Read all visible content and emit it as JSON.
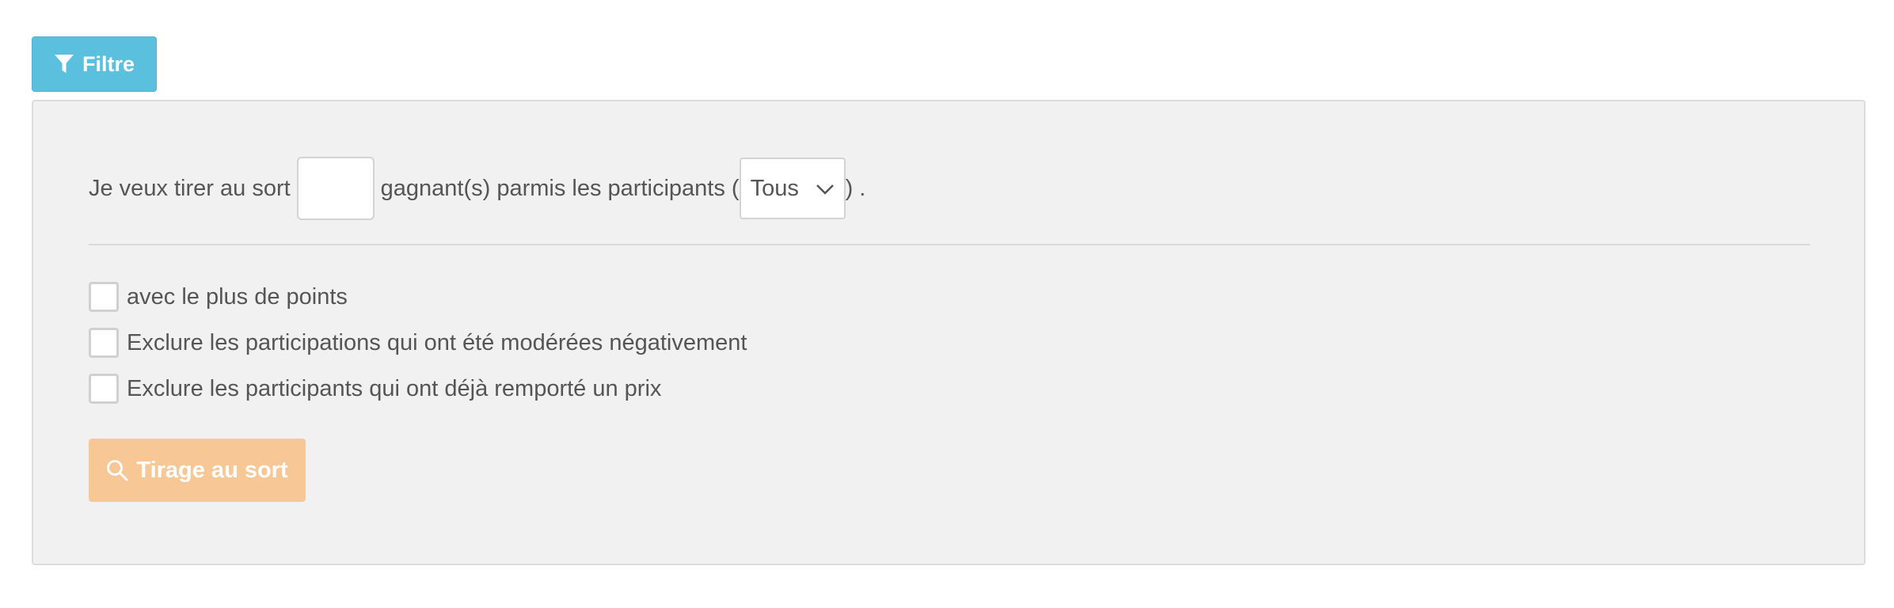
{
  "filter_button": {
    "label": "Filtre",
    "icon": "filter-icon",
    "color": "#5bc0de"
  },
  "draw_form": {
    "sentence_start": "Je veux tirer au sort",
    "count_value": "",
    "sentence_middle": "gagnant(s) parmis les participants (",
    "participants_select": {
      "selected": "Tous",
      "icon": "chevron-down-icon"
    },
    "sentence_end": ") .",
    "options": [
      {
        "label": "avec le plus de points",
        "checked": false
      },
      {
        "label": "Exclure les participations qui ont été modérées négativement",
        "checked": false
      },
      {
        "label": "Exclure les participants qui ont déjà remporté un prix",
        "checked": false
      }
    ],
    "submit_button": {
      "label": "Tirage au sort",
      "icon": "search-icon",
      "color": "#f7c896"
    }
  }
}
